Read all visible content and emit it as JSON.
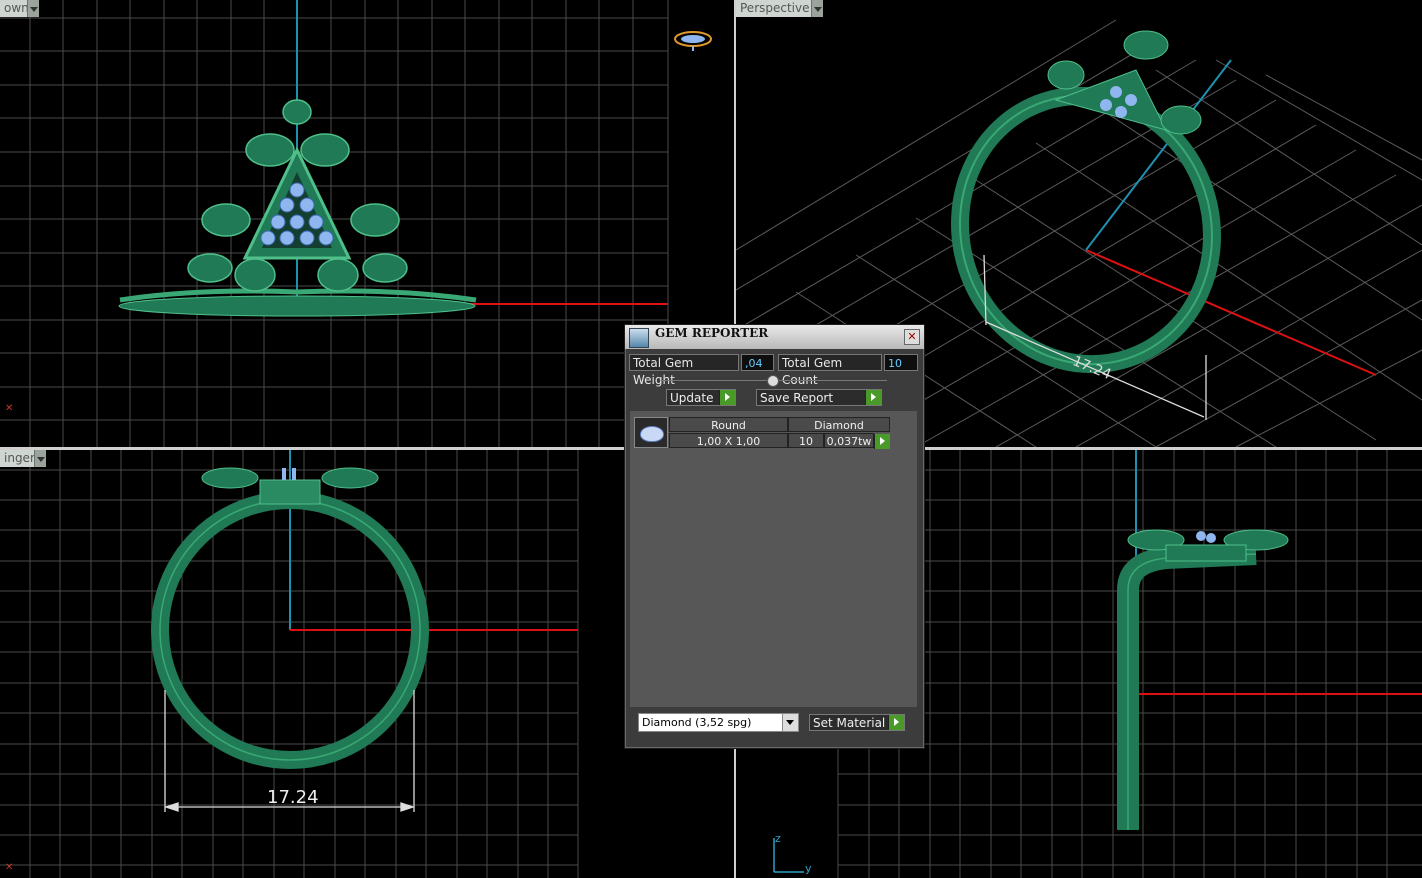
{
  "viewports": {
    "top_left": {
      "label": "own"
    },
    "top_right": {
      "label": "Perspective"
    },
    "bottom_left": {
      "label": "inger",
      "dimension": "17.24"
    },
    "bottom_right": {},
    "perspective_dimension": "17.24"
  },
  "axis_indicator": {
    "z": "z",
    "y": "y"
  },
  "gem_reporter": {
    "title": "GEM REPORTER",
    "total_weight_label": "Total Gem Weight",
    "total_weight_value": ",04",
    "total_count_label": "Total Gem Count",
    "total_count_value": "10",
    "update_label": "Update",
    "save_report_label": "Save Report",
    "table": {
      "col_shape": "Round",
      "col_type": "Diamond",
      "row": {
        "size": "1,00 X 1,00",
        "count": "10",
        "weight": "0,037tw"
      }
    },
    "material_select": "Diamond     (3,52 spg)",
    "set_material_label": "Set Material"
  },
  "colors": {
    "ring": "#1f7a55",
    "gem": "#8fb6ee",
    "grid": "#555555",
    "x_axis": "#d11",
    "y_axis": "#1e90b0"
  }
}
